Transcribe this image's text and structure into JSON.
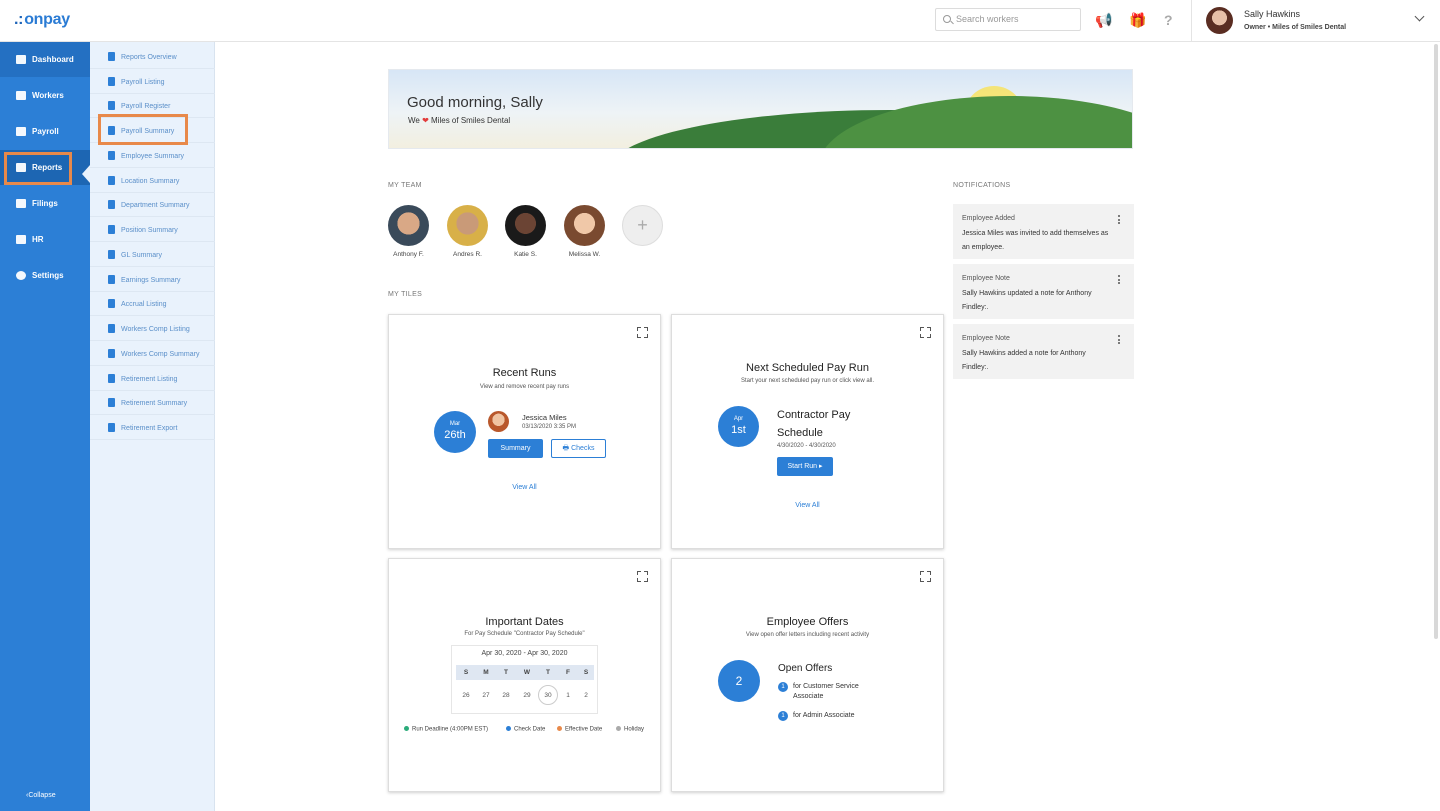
{
  "brand": {
    "logo": "onpay"
  },
  "header": {
    "search_placeholder": "Search workers",
    "user_name": "Sally Hawkins",
    "user_role": "Owner • Miles of Smiles Dental"
  },
  "left_nav": {
    "items": [
      {
        "label": "Dashboard"
      },
      {
        "label": "Workers"
      },
      {
        "label": "Payroll"
      },
      {
        "label": "Reports"
      },
      {
        "label": "Filings"
      },
      {
        "label": "HR"
      },
      {
        "label": "Settings"
      }
    ],
    "collapse": "Collapse"
  },
  "sub_nav": {
    "items": [
      "Reports Overview",
      "Payroll Listing",
      "Payroll Register",
      "Payroll Summary",
      "Employee Summary",
      "Location Summary",
      "Department Summary",
      "Position Summary",
      "GL Summary",
      "Earnings Summary",
      "Accrual Listing",
      "Workers Comp Listing",
      "Workers Comp Summary",
      "Retirement Listing",
      "Retirement Summary",
      "Retirement Export"
    ]
  },
  "banner": {
    "greeting": "Good morning, Sally",
    "prefix": "We",
    "company": "Miles of Smiles Dental"
  },
  "team": {
    "label": "MY TEAM",
    "members": [
      "Anthony F.",
      "Andres R.",
      "Katie S.",
      "Melissa W."
    ],
    "add": "+"
  },
  "tiles_label": "MY TILES",
  "recent_runs": {
    "title": "Recent Runs",
    "subtitle": "View and remove recent pay runs",
    "month": "Mar",
    "day": "26th",
    "employee": "Jessica Miles",
    "datetime": "03/13/2020 3:35 PM",
    "summary_btn": "Summary",
    "checks_btn": "Checks",
    "view_all": "View All"
  },
  "next_run": {
    "title": "Next Scheduled Pay Run",
    "subtitle": "Start your next scheduled pay run or click view all.",
    "month": "Apr",
    "day": "1st",
    "schedule_line1": "Contractor Pay",
    "schedule_line2": "Schedule",
    "range": "4/30/2020 - 4/30/2020",
    "start_btn": "Start Run ▸",
    "view_all": "View All"
  },
  "important_dates": {
    "title": "Important Dates",
    "subtitle": "For Pay Schedule \"Contractor Pay Schedule\"",
    "range": "Apr 30, 2020 - Apr 30, 2020",
    "weekdays": [
      "S",
      "M",
      "T",
      "W",
      "T",
      "F",
      "S"
    ],
    "days": [
      "26",
      "27",
      "28",
      "29",
      "30",
      "1",
      "2"
    ],
    "legend": [
      {
        "label": "Run Deadline (4:00PM EST)",
        "color": "#2bab7a"
      },
      {
        "label": "Check Date",
        "color": "#2c7fd6"
      },
      {
        "label": "Effective Date",
        "color": "#e8894a"
      },
      {
        "label": "Holiday",
        "color": "#aaaaaa"
      }
    ]
  },
  "offers": {
    "title": "Employee Offers",
    "subtitle": "View open offer letters including recent activity",
    "count": "2",
    "heading": "Open Offers",
    "items": [
      {
        "num": "1",
        "line1": "for Customer Service",
        "line2": "Associate"
      },
      {
        "num": "1",
        "line1": "for Admin Associate",
        "line2": ""
      }
    ]
  },
  "notifications": {
    "label": "NOTIFICATIONS",
    "items": [
      {
        "type": "Employee Added",
        "body": "Jessica Miles was invited to add themselves as an employee."
      },
      {
        "type": "Employee Note",
        "body": "Sally Hawkins updated a note for Anthony Findley:."
      },
      {
        "type": "Employee Note",
        "body": "Sally Hawkins added a note for Anthony Findley:."
      }
    ]
  },
  "colors": {
    "brand_blue": "#2c7fd6",
    "highlight": "#e8894a"
  }
}
